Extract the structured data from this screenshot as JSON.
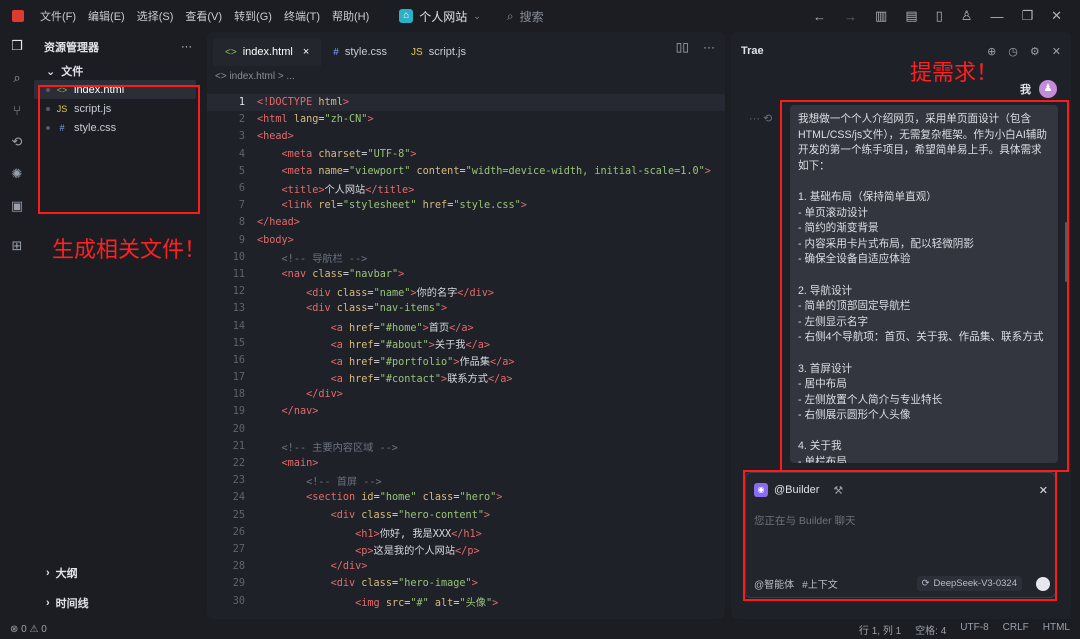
{
  "menu": [
    "文件(F)",
    "编辑(E)",
    "选择(S)",
    "查看(V)",
    "转到(G)",
    "终端(T)",
    "帮助(H)"
  ],
  "project_name": "个人网站",
  "search_label": "搜索",
  "explorer": {
    "title": "资源管理器",
    "folder": "文件",
    "files": [
      {
        "name": "index.html",
        "icon": "<>",
        "color": "#7fbf5a"
      },
      {
        "name": "script.js",
        "icon": "JS",
        "color": "#e6c84a"
      },
      {
        "name": "style.css",
        "icon": "#",
        "color": "#7aa2f7"
      }
    ],
    "outline": "大纲",
    "timeline": "时间线"
  },
  "annotations": {
    "files": "生成相关文件！",
    "request": "提需求！"
  },
  "editor": {
    "tabs": [
      {
        "name": "index.html",
        "icon": "<>",
        "close": "×"
      },
      {
        "name": "style.css",
        "icon": "#"
      },
      {
        "name": "script.js",
        "icon": "JS"
      }
    ],
    "breadcrumb": "<> index.html > ...",
    "lines": [
      [
        [
          "tag",
          "<!DOCTYPE "
        ],
        [
          "attr",
          "html"
        ],
        [
          "tag",
          ">"
        ]
      ],
      [
        [
          "tag",
          "<html "
        ],
        [
          "attr",
          "lang"
        ],
        [
          "txt",
          "="
        ],
        [
          "str",
          "\"zh-CN\""
        ],
        [
          "tag",
          ">"
        ]
      ],
      [
        [
          "tag",
          "<head>"
        ]
      ],
      [
        [
          "txt",
          "    "
        ],
        [
          "tag",
          "<meta "
        ],
        [
          "attr",
          "charset"
        ],
        [
          "txt",
          "="
        ],
        [
          "str",
          "\"UTF-8\""
        ],
        [
          "tag",
          ">"
        ]
      ],
      [
        [
          "txt",
          "    "
        ],
        [
          "tag",
          "<meta "
        ],
        [
          "attr",
          "name"
        ],
        [
          "txt",
          "="
        ],
        [
          "str",
          "\"viewport\" "
        ],
        [
          "attr",
          "content"
        ],
        [
          "txt",
          "="
        ],
        [
          "str",
          "\"width=device-width, initial-scale=1.0\""
        ],
        [
          "tag",
          ">"
        ]
      ],
      [
        [
          "txt",
          "    "
        ],
        [
          "tag",
          "<title>"
        ],
        [
          "txt",
          "个人网站"
        ],
        [
          "tag",
          "</title>"
        ]
      ],
      [
        [
          "txt",
          "    "
        ],
        [
          "tag",
          "<link "
        ],
        [
          "attr",
          "rel"
        ],
        [
          "txt",
          "="
        ],
        [
          "str",
          "\"stylesheet\" "
        ],
        [
          "attr",
          "href"
        ],
        [
          "txt",
          "="
        ],
        [
          "str",
          "\"style.css\""
        ],
        [
          "tag",
          ">"
        ]
      ],
      [
        [
          "tag",
          "</head>"
        ]
      ],
      [
        [
          "tag",
          "<body>"
        ]
      ],
      [
        [
          "txt",
          "    "
        ],
        [
          "cm",
          "<!-- 导航栏 -->"
        ]
      ],
      [
        [
          "txt",
          "    "
        ],
        [
          "tag",
          "<nav "
        ],
        [
          "attr",
          "class"
        ],
        [
          "txt",
          "="
        ],
        [
          "str",
          "\"navbar\""
        ],
        [
          "tag",
          ">"
        ]
      ],
      [
        [
          "txt",
          "        "
        ],
        [
          "tag",
          "<div "
        ],
        [
          "attr",
          "class"
        ],
        [
          "txt",
          "="
        ],
        [
          "str",
          "\"name\""
        ],
        [
          "tag",
          ">"
        ],
        [
          "txt",
          "你的名字"
        ],
        [
          "tag",
          "</div>"
        ]
      ],
      [
        [
          "txt",
          "        "
        ],
        [
          "tag",
          "<div "
        ],
        [
          "attr",
          "class"
        ],
        [
          "txt",
          "="
        ],
        [
          "str",
          "\"nav-items\""
        ],
        [
          "tag",
          ">"
        ]
      ],
      [
        [
          "txt",
          "            "
        ],
        [
          "tag",
          "<a "
        ],
        [
          "attr",
          "href"
        ],
        [
          "txt",
          "="
        ],
        [
          "str",
          "\"#home\""
        ],
        [
          "tag",
          ">"
        ],
        [
          "txt",
          "首页"
        ],
        [
          "tag",
          "</a>"
        ]
      ],
      [
        [
          "txt",
          "            "
        ],
        [
          "tag",
          "<a "
        ],
        [
          "attr",
          "href"
        ],
        [
          "txt",
          "="
        ],
        [
          "str",
          "\"#about\""
        ],
        [
          "tag",
          ">"
        ],
        [
          "txt",
          "关于我"
        ],
        [
          "tag",
          "</a>"
        ]
      ],
      [
        [
          "txt",
          "            "
        ],
        [
          "tag",
          "<a "
        ],
        [
          "attr",
          "href"
        ],
        [
          "txt",
          "="
        ],
        [
          "str",
          "\"#portfolio\""
        ],
        [
          "tag",
          ">"
        ],
        [
          "txt",
          "作品集"
        ],
        [
          "tag",
          "</a>"
        ]
      ],
      [
        [
          "txt",
          "            "
        ],
        [
          "tag",
          "<a "
        ],
        [
          "attr",
          "href"
        ],
        [
          "txt",
          "="
        ],
        [
          "str",
          "\"#contact\""
        ],
        [
          "tag",
          ">"
        ],
        [
          "txt",
          "联系方式"
        ],
        [
          "tag",
          "</a>"
        ]
      ],
      [
        [
          "txt",
          "        "
        ],
        [
          "tag",
          "</div>"
        ]
      ],
      [
        [
          "txt",
          "    "
        ],
        [
          "tag",
          "</nav>"
        ]
      ],
      [
        [
          "txt",
          ""
        ]
      ],
      [
        [
          "txt",
          "    "
        ],
        [
          "cm",
          "<!-- 主要内容区域 -->"
        ]
      ],
      [
        [
          "txt",
          "    "
        ],
        [
          "tag",
          "<main>"
        ]
      ],
      [
        [
          "txt",
          "        "
        ],
        [
          "cm",
          "<!-- 首屏 -->"
        ]
      ],
      [
        [
          "txt",
          "        "
        ],
        [
          "tag",
          "<section "
        ],
        [
          "attr",
          "id"
        ],
        [
          "txt",
          "="
        ],
        [
          "str",
          "\"home\" "
        ],
        [
          "attr",
          "class"
        ],
        [
          "txt",
          "="
        ],
        [
          "str",
          "\"hero\""
        ],
        [
          "tag",
          ">"
        ]
      ],
      [
        [
          "txt",
          "            "
        ],
        [
          "tag",
          "<div "
        ],
        [
          "attr",
          "class"
        ],
        [
          "txt",
          "="
        ],
        [
          "str",
          "\"hero-content\""
        ],
        [
          "tag",
          ">"
        ]
      ],
      [
        [
          "txt",
          "                "
        ],
        [
          "tag",
          "<h1>"
        ],
        [
          "txt",
          "你好, 我是XXX"
        ],
        [
          "tag",
          "</h1>"
        ]
      ],
      [
        [
          "txt",
          "                "
        ],
        [
          "tag",
          "<p>"
        ],
        [
          "txt",
          "这是我的个人网站"
        ],
        [
          "tag",
          "</p>"
        ]
      ],
      [
        [
          "txt",
          "            "
        ],
        [
          "tag",
          "</div>"
        ]
      ],
      [
        [
          "txt",
          "            "
        ],
        [
          "tag",
          "<div "
        ],
        [
          "attr",
          "class"
        ],
        [
          "txt",
          "="
        ],
        [
          "str",
          "\"hero-image\""
        ],
        [
          "tag",
          ">"
        ]
      ],
      [
        [
          "txt",
          "                "
        ],
        [
          "tag",
          "<img "
        ],
        [
          "attr",
          "src"
        ],
        [
          "txt",
          "="
        ],
        [
          "str",
          "\"#\" "
        ],
        [
          "attr",
          "alt"
        ],
        [
          "txt",
          "="
        ],
        [
          "str",
          "\"头像\""
        ],
        [
          "tag",
          ">"
        ]
      ]
    ]
  },
  "chat": {
    "title": "Trae",
    "user": "我",
    "message": [
      "我想做一个个人介绍网页，采用单页面设计（包含HTML/CSS/js文件），无需复杂框架。作为小白AI辅助开发的第一个练手项目，希望简单易上手。具体需求如下：",
      "",
      "1. 基础布局（保持简单直观）",
      "- 单页滚动设计",
      "- 简约的渐变背景",
      "- 内容采用卡片式布局，配以轻微阴影",
      "- 确保全设备自适应体验",
      "",
      "2. 导航设计",
      "- 简单的顶部固定导航栏",
      "- 左侧显示名字",
      "- 右侧4个导航项：首页、关于我、作品集、联系方式",
      "",
      "3. 首屏设计",
      "- 居中布局",
      "- 左侧放置个人简介与专业特长",
      "- 右侧展示圆形个人头像",
      "",
      "4. 关于我",
      "- 单栏布局"
    ],
    "builder": "@Builder",
    "placeholder": "您正在与 Builder 聊天",
    "footer": {
      "agent": "@智能体",
      "context": "#上下文",
      "model": "DeepSeek-V3-0324"
    }
  },
  "status": {
    "left": "⊗ 0 ⚠ 0",
    "right": [
      "行 1, 列 1",
      "空格: 4",
      "UTF-8",
      "CRLF",
      "HTML"
    ]
  }
}
